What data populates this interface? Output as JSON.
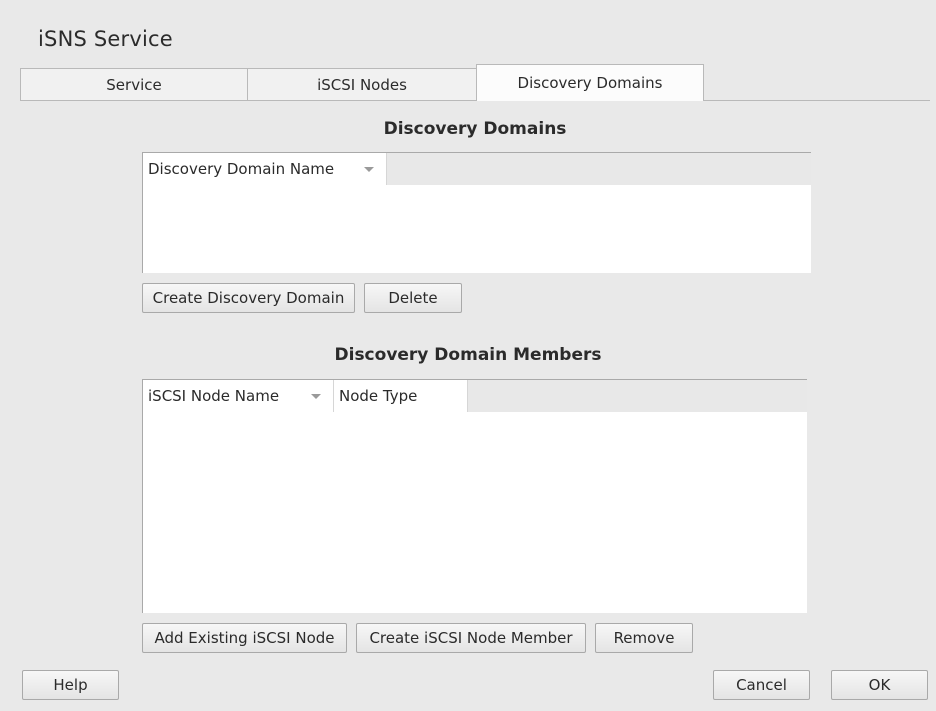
{
  "window": {
    "title": "iSNS Service"
  },
  "tabs": [
    {
      "label": "Service",
      "active": false
    },
    {
      "label": "iSCSI Nodes",
      "active": false
    },
    {
      "label": "Discovery Domains",
      "active": true
    }
  ],
  "domains": {
    "title": "Discovery Domains",
    "columns": [
      "Discovery Domain Name"
    ],
    "rows": [],
    "create_label": "Create Discovery Domain",
    "delete_label": "Delete"
  },
  "members": {
    "title": "Discovery Domain Members",
    "columns": [
      "iSCSI Node Name",
      "Node Type"
    ],
    "rows": [],
    "add_existing_label": "Add Existing iSCSI Node",
    "create_member_label": "Create iSCSI Node Member",
    "remove_label": "Remove"
  },
  "footer": {
    "help_label": "Help",
    "cancel_label": "Cancel",
    "ok_label": "OK"
  },
  "icons": {
    "sort": "chevron-down-icon"
  }
}
